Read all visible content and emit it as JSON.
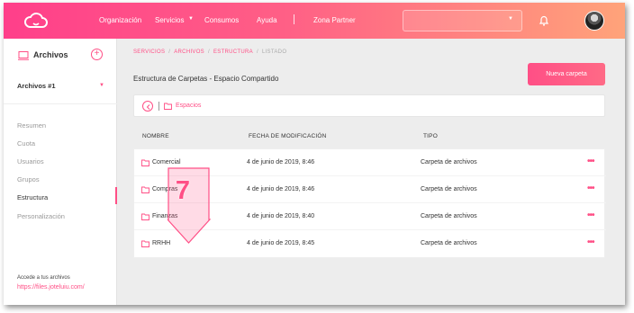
{
  "nav": {
    "items": [
      "Organización",
      "Servicios",
      "Consumos",
      "Ayuda",
      "Zona Partner"
    ]
  },
  "sidebar": {
    "title": "Archivos",
    "selected": "Archivos #1",
    "items": [
      "Resumen",
      "Cuota",
      "Usuarios",
      "Grupos",
      "Estructura",
      "Personalización"
    ],
    "active_item": "Estructura",
    "access_text": "Accede a tus archivos",
    "access_link": "https://files.joteluiu.com/"
  },
  "breadcrumb": [
    "SERVICIOS",
    "ARCHIVOS",
    "ESTRUCTURA",
    "LISTADO"
  ],
  "page": {
    "title": "Estructura de Carpetas - Espacio Compartido",
    "new_button": "Nueva carpeta",
    "path_label": "Espacios"
  },
  "table": {
    "headers": [
      "NOMBRE",
      "FECHA DE MODIFICACIÓN",
      "TIPO"
    ],
    "rows": [
      {
        "name": "Comercial",
        "date": "4 de junio de 2019, 8:46",
        "type": "Carpeta de archivos"
      },
      {
        "name": "Compras",
        "date": "4 de junio de 2019, 8:46",
        "type": "Carpeta de archivos"
      },
      {
        "name": "Finanzas",
        "date": "4 de junio de 2019, 8:40",
        "type": "Carpeta de archivos"
      },
      {
        "name": "RRHH",
        "date": "4 de junio de 2019, 8:45",
        "type": "Carpeta de archivos"
      }
    ],
    "row_menu_glyph": "•••"
  },
  "callout": {
    "number": "7"
  },
  "colors": {
    "accent": "#ff4f86",
    "header_start": "#ff3f8a",
    "header_end": "#ffa37a"
  },
  "icons": [
    "cloud-logo-icon",
    "bell-icon",
    "folder-icon",
    "back-circle-icon",
    "computer-icon",
    "plus-circle-icon",
    "more-dots-icon",
    "down-arrow-callout-icon"
  ]
}
